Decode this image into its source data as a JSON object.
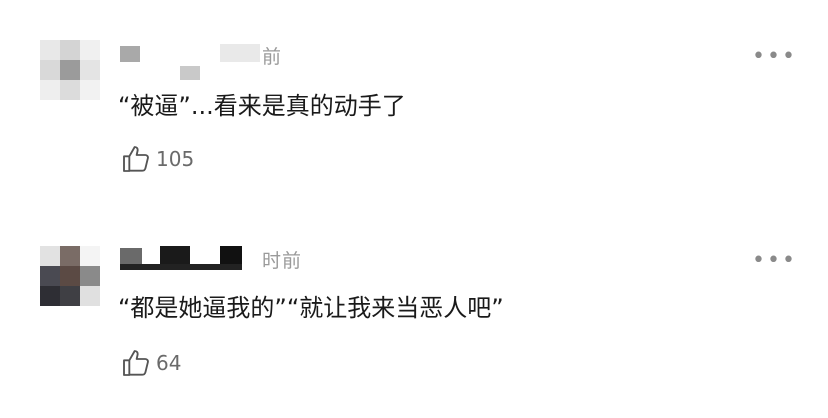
{
  "comments": [
    {
      "time_label": "前",
      "text": "“被逼”...看来是真的动手了",
      "likes": "105"
    },
    {
      "time_label": "时前",
      "text": "“都是她逼我的”“就让我来当恶人吧”",
      "likes": "64"
    }
  ],
  "icons": {
    "more": "more-dots-icon",
    "like": "thumbs-up-icon"
  }
}
